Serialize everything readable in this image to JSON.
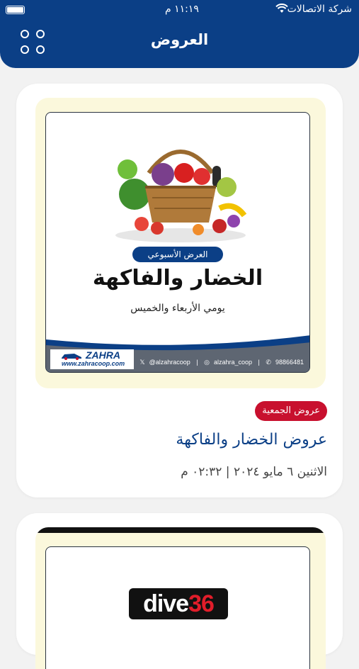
{
  "status_bar": {
    "carrier": "شركة الاتصالات",
    "time": "١١:١٩ م"
  },
  "header": {
    "title": "العروض"
  },
  "offers": [
    {
      "poster": {
        "pill": "العرض الأسبوعي",
        "title": "الخضار والفاكهة",
        "subtitle": "يومي الأربعاء والخميس",
        "logo_brand": "ZAHRA",
        "logo_url": "www.zahracoop.com",
        "social_x": "@alzahracoop",
        "social_ig": "alzahra_coop",
        "social_wa": "98866481"
      },
      "tag": "عروض الجمعية",
      "title": "عروض الخضار والفاكهة",
      "date": "الاثنين ٦ مايو ٢٠٢٤ | ٠٢:٣٢ م"
    },
    {
      "poster": {
        "logo_main": "dive",
        "logo_num": "36"
      }
    }
  ],
  "colors": {
    "primary": "#0b3f86",
    "tag": "#c8102e",
    "poster_bg": "#fbf8dc",
    "background": "#f2f2f2"
  }
}
